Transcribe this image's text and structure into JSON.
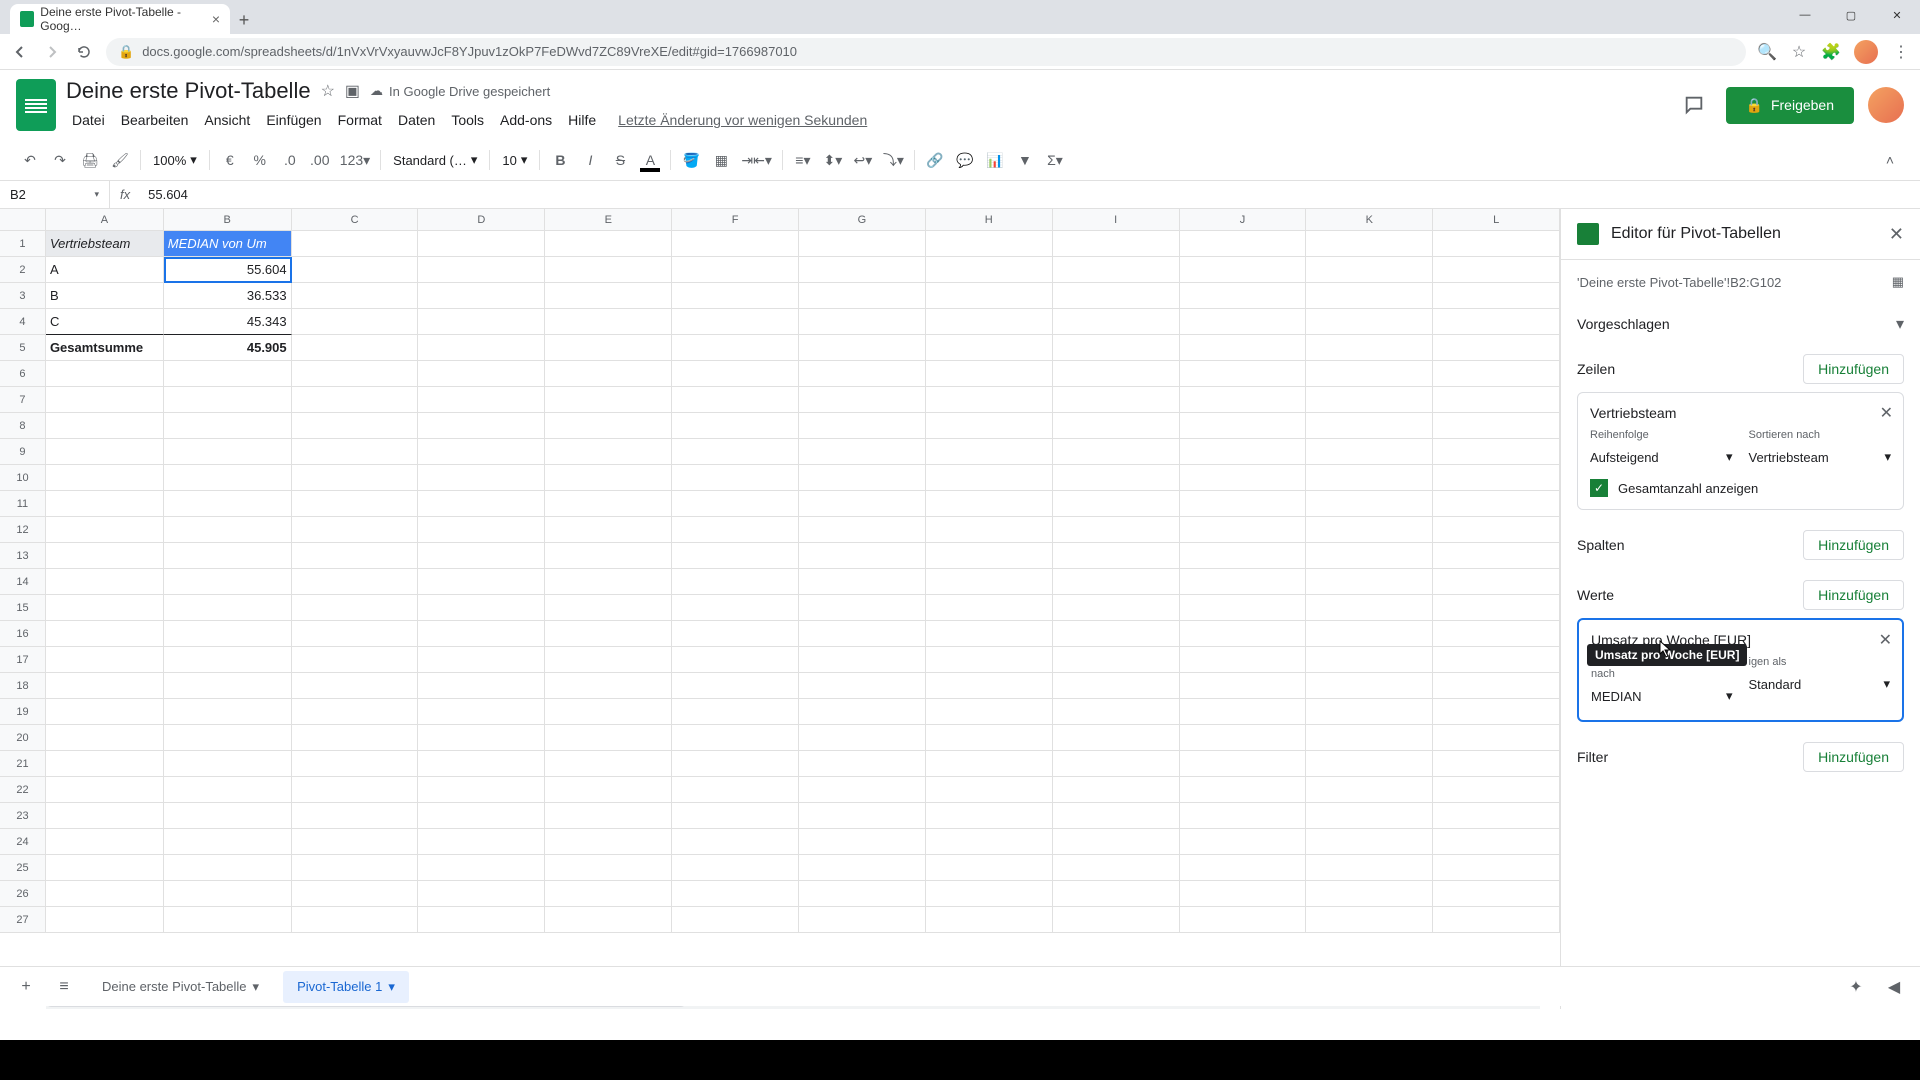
{
  "browser": {
    "tab_title": "Deine erste Pivot-Tabelle - Goog…",
    "url": "docs.google.com/spreadsheets/d/1nVxVrVxyauvwJcF8YJpuv1zOkP7FeDWvd7ZC89VreXE/edit#gid=1766987010"
  },
  "doc": {
    "title": "Deine erste Pivot-Tabelle",
    "save_status": "In Google Drive gespeichert",
    "recent": "Letzte Änderung vor wenigen Sekunden"
  },
  "menu": {
    "file": "Datei",
    "edit": "Bearbeiten",
    "view": "Ansicht",
    "insert": "Einfügen",
    "format": "Format",
    "data": "Daten",
    "tools": "Tools",
    "addons": "Add-ons",
    "help": "Hilfe"
  },
  "share": {
    "label": "Freigeben"
  },
  "toolbar": {
    "zoom": "100%",
    "fmt123": "123",
    "font": "Standard (…",
    "size": "10"
  },
  "namebox": "B2",
  "formula": "55.604",
  "cols": [
    "A",
    "B",
    "C",
    "D",
    "E",
    "F",
    "G",
    "H",
    "I",
    "J",
    "K",
    "L"
  ],
  "sheet": {
    "h1": "Vertriebsteam",
    "h2": "MEDIAN von Um",
    "r2a": "A",
    "r2b": "55.604",
    "r3a": "B",
    "r3b": "36.533",
    "r4a": "C",
    "r4b": "45.343",
    "r5a": "Gesamtsumme",
    "r5b": "45.905"
  },
  "pivot": {
    "title": "Editor für Pivot-Tabellen",
    "range": "'Deine erste Pivot-Tabelle'!B2:G102",
    "suggested": "Vorgeschlagen",
    "rows_title": "Zeilen",
    "cols_title": "Spalten",
    "values_title": "Werte",
    "filter_title": "Filter",
    "add": "Hinzufügen",
    "row_field": {
      "name": "Vertriebsteam",
      "order_label": "Reihenfolge",
      "order_value": "Aufsteigend",
      "sort_label": "Sortieren nach",
      "sort_value": "Vertriebsteam",
      "show_totals": "Gesamtanzahl anzeigen"
    },
    "value_field": {
      "name": "Umsatz pro Woche [EUR]",
      "tooltip": "Umsatz pro Woche [EUR]",
      "sumby_label_a": "Z",
      "sumby_label_b": "nach",
      "sumby_value": "MEDIAN",
      "showas_label": "igen als",
      "showas_value": "Standard"
    }
  },
  "tabs": {
    "t1": "Deine erste Pivot-Tabelle",
    "t2": "Pivot-Tabelle 1"
  }
}
